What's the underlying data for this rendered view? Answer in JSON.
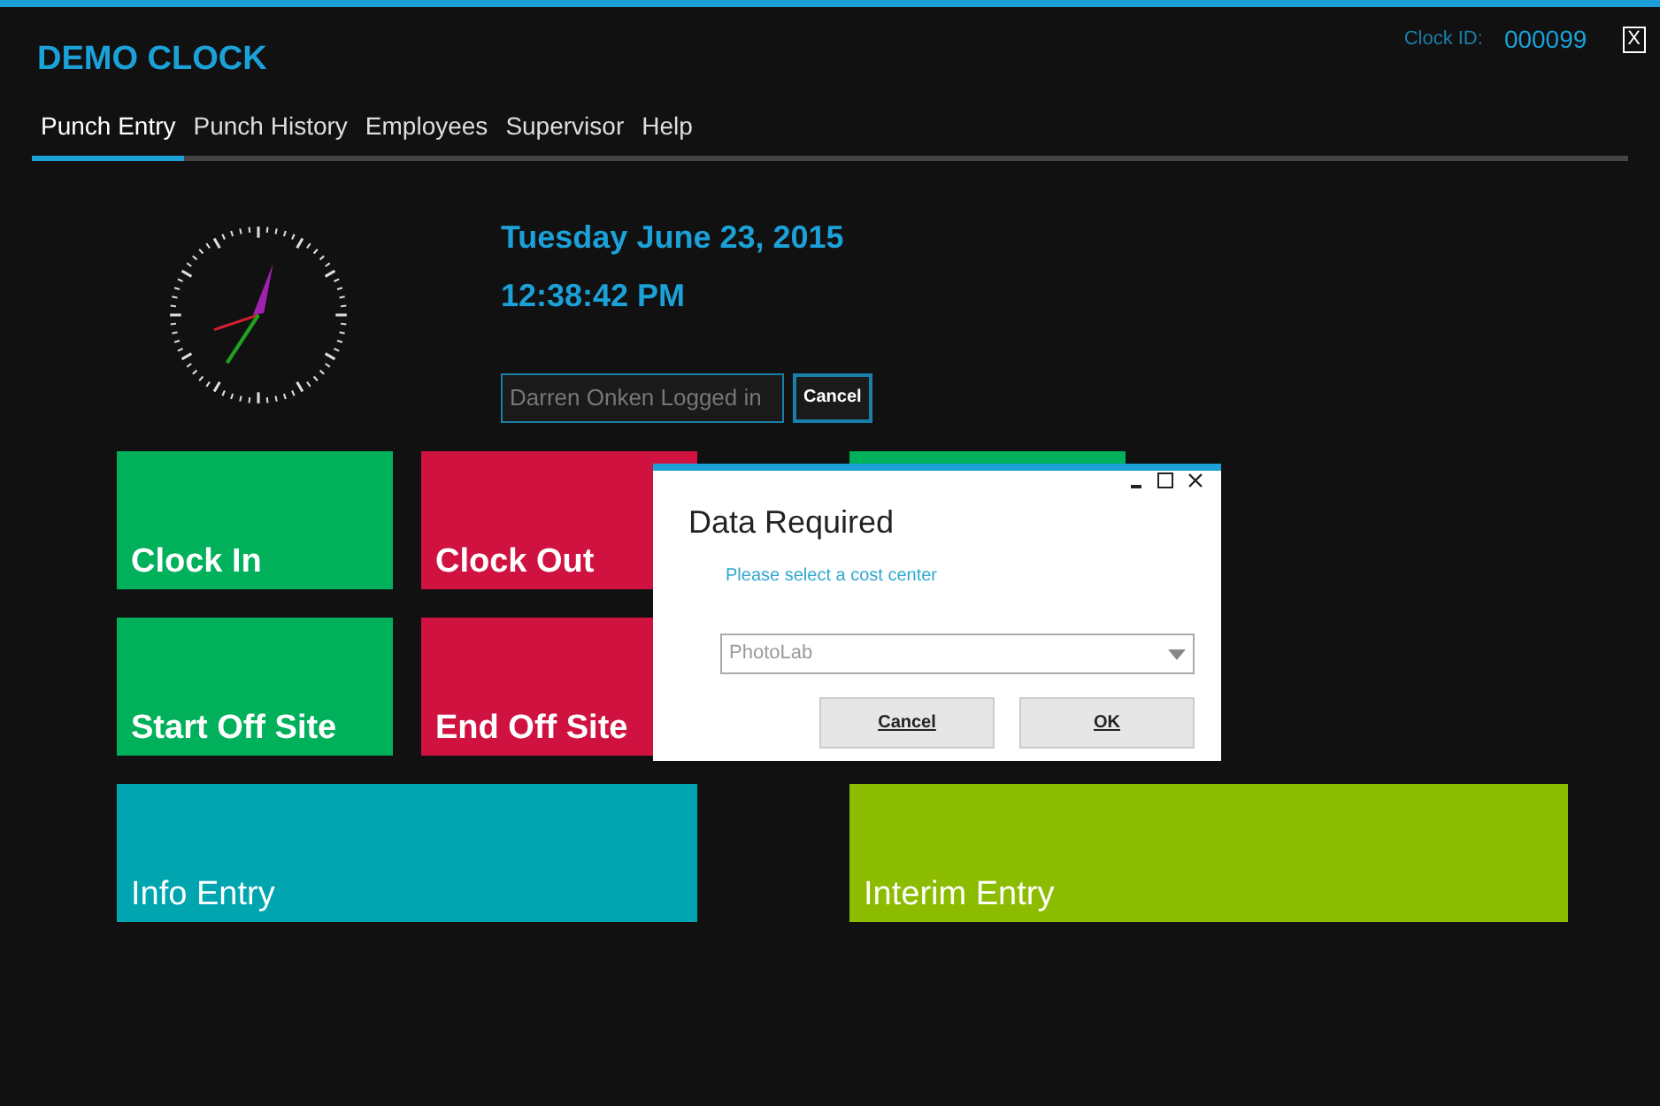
{
  "app": {
    "title": "DEMO CLOCK",
    "clock_id_label": "Clock ID:",
    "clock_id": "000099",
    "close": "X"
  },
  "tabs": [
    {
      "label": "Punch Entry",
      "selected": true
    },
    {
      "label": "Punch History",
      "selected": false
    },
    {
      "label": "Employees",
      "selected": false
    },
    {
      "label": "Supervisor",
      "selected": false
    },
    {
      "label": "Help",
      "selected": false
    }
  ],
  "date": "Tuesday June 23, 2015",
  "time": "12:38:42 PM",
  "login": {
    "value": "Darren Onken Logged in",
    "cancel": "Cancel"
  },
  "tile_rows": [
    [
      {
        "label": "Clock In",
        "color": "#00b05a",
        "kind": "small"
      },
      {
        "label": "Clock Out",
        "color": "#d01240",
        "kind": "small"
      },
      {
        "color": "#00b05a",
        "kind": "covered"
      }
    ],
    [
      {
        "label": "Start Off Site",
        "color": "#00b05a",
        "kind": "small"
      },
      {
        "label": "End Off Site",
        "color": "#d01240",
        "kind": "small"
      }
    ],
    [
      {
        "label": "Info Entry",
        "color": "#00a5b0",
        "kind": "wide"
      },
      {
        "label": "Interim Entry",
        "color": "#8cbc00",
        "kind": "wider"
      }
    ]
  ],
  "dialog": {
    "title": "Data Required",
    "prompt": "Please select a cost center",
    "select_value": "PhotoLab",
    "buttons": [
      {
        "label": "Cancel"
      },
      {
        "label": "OK"
      }
    ]
  }
}
